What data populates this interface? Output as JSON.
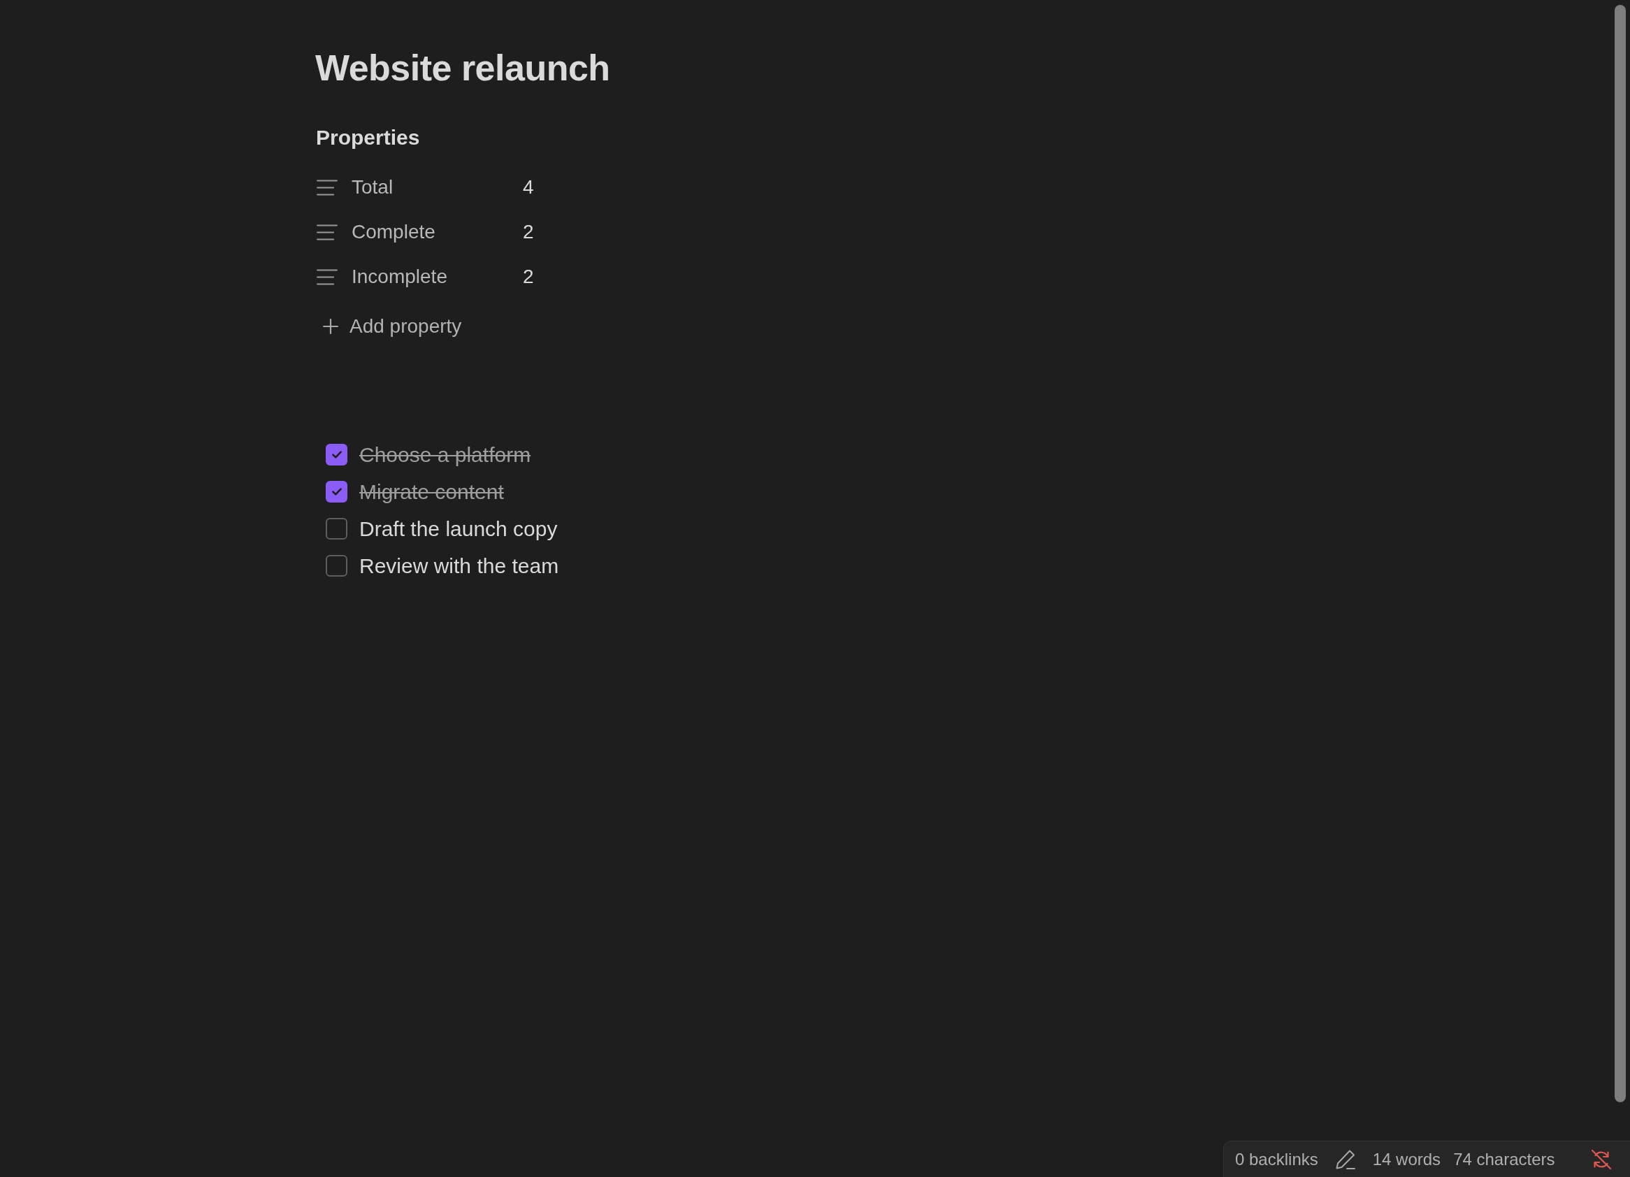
{
  "note": {
    "title": "Website relaunch"
  },
  "properties": {
    "heading": "Properties",
    "items": [
      {
        "name": "Total",
        "value": "4"
      },
      {
        "name": "Complete",
        "value": "2"
      },
      {
        "name": "Incomplete",
        "value": "2"
      }
    ],
    "add_label": "Add property"
  },
  "tasks": [
    {
      "text": "Choose a platform",
      "checked": true
    },
    {
      "text": "Migrate content",
      "checked": true
    },
    {
      "text": "Draft the launch copy",
      "checked": false
    },
    {
      "text": "Review with the team",
      "checked": false
    }
  ],
  "status_bar": {
    "backlinks": "0 backlinks",
    "words": "14 words",
    "characters": "74 characters"
  }
}
